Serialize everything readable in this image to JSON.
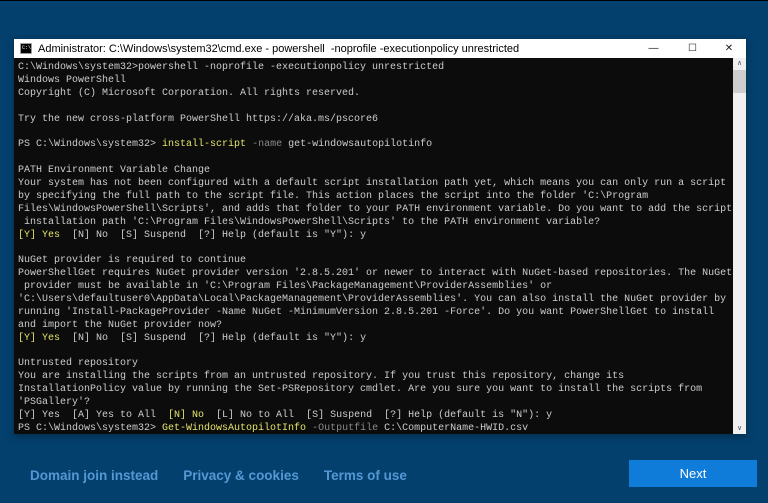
{
  "colors": {
    "page_background": "#04406e",
    "accent_button": "#0e7cd8",
    "footer_link": "#5498d3",
    "console_background": "#0c0c0c",
    "console_text": "#cccccc",
    "console_highlight_yellow": "#e3e36c",
    "console_parameter_gray": "#8a8a8a",
    "titlebar_background": "#ffffff",
    "titlebar_text": "#000000"
  },
  "window": {
    "title": "Administrator: C:\\Windows\\system32\\cmd.exe - powershell  -noprofile -executionpolicy unrestricted",
    "icon_text": "C:\\",
    "controls": {
      "minimize_glyph": "—",
      "maximize_glyph": "☐",
      "close_glyph": "✕"
    }
  },
  "console": {
    "scrollbar": {
      "up_glyph": "∧",
      "down_glyph": "∨"
    },
    "lines": [
      [
        [
          "d",
          "C:\\Windows\\system32>powershell -noprofile -executionpolicy unrestricted"
        ]
      ],
      [
        [
          "d",
          "Windows PowerShell"
        ]
      ],
      [
        [
          "d",
          "Copyright (C) Microsoft Corporation. All rights reserved."
        ]
      ],
      [],
      [
        [
          "d",
          "Try the new cross-platform PowerShell https://aka.ms/pscore6"
        ]
      ],
      [],
      [
        [
          "d",
          "PS C:\\Windows\\system32> "
        ],
        [
          "y",
          "install-script"
        ],
        [
          "d",
          " "
        ],
        [
          "g",
          "-name"
        ],
        [
          "d",
          " get-windowsautopilotinfo"
        ]
      ],
      [],
      [
        [
          "d",
          "PATH Environment Variable Change"
        ]
      ],
      [
        [
          "d",
          "Your system has not been configured with a default script installation path yet, which means you can only run a script"
        ]
      ],
      [
        [
          "d",
          "by specifying the full path to the script file. This action places the script into the folder 'C:\\Program"
        ]
      ],
      [
        [
          "d",
          "Files\\WindowsPowerShell\\Scripts', and adds that folder to your PATH environment variable. Do you want to add the script"
        ]
      ],
      [
        [
          "d",
          " installation path 'C:\\Program Files\\WindowsPowerShell\\Scripts' to the PATH environment variable?"
        ]
      ],
      [
        [
          "y",
          "[Y] Yes"
        ],
        [
          "d",
          "  [N] No  [S] Suspend  [?] Help (default is \"Y\"): y"
        ]
      ],
      [],
      [
        [
          "d",
          "NuGet provider is required to continue"
        ]
      ],
      [
        [
          "d",
          "PowerShellGet requires NuGet provider version '2.8.5.201' or newer to interact with NuGet-based repositories. The NuGet"
        ]
      ],
      [
        [
          "d",
          " provider must be available in 'C:\\Program Files\\PackageManagement\\ProviderAssemblies' or"
        ]
      ],
      [
        [
          "d",
          "'C:\\Users\\defaultuser0\\AppData\\Local\\PackageManagement\\ProviderAssemblies'. You can also install the NuGet provider by"
        ]
      ],
      [
        [
          "d",
          "running 'Install-PackageProvider -Name NuGet -MinimumVersion 2.8.5.201 -Force'. Do you want PowerShellGet to install"
        ]
      ],
      [
        [
          "d",
          "and import the NuGet provider now?"
        ]
      ],
      [
        [
          "y",
          "[Y] Yes"
        ],
        [
          "d",
          "  [N] No  [S] Suspend  [?] Help (default is \"Y\"): y"
        ]
      ],
      [],
      [
        [
          "d",
          "Untrusted repository"
        ]
      ],
      [
        [
          "d",
          "You are installing the scripts from an untrusted repository. If you trust this repository, change its"
        ]
      ],
      [
        [
          "d",
          "InstallationPolicy value by running the Set-PSRepository cmdlet. Are you sure you want to install the scripts from"
        ]
      ],
      [
        [
          "d",
          "'PSGallery'?"
        ]
      ],
      [
        [
          "d",
          "[Y] Yes  [A] Yes to All  "
        ],
        [
          "y",
          "[N] No"
        ],
        [
          "d",
          "  [L] No to All  [S] Suspend  [?] Help (default is \"N\"): y"
        ]
      ],
      [
        [
          "d",
          "PS C:\\Windows\\system32> "
        ],
        [
          "y",
          "Get-WindowsAutopilotInfo"
        ],
        [
          "d",
          " "
        ],
        [
          "g",
          "-Outputfile"
        ],
        [
          "d",
          " C:\\ComputerName-HWID.csv"
        ]
      ]
    ]
  },
  "footer": {
    "links": [
      "Domain join instead",
      "Privacy & cookies",
      "Terms of use"
    ],
    "next_label": "Next"
  }
}
